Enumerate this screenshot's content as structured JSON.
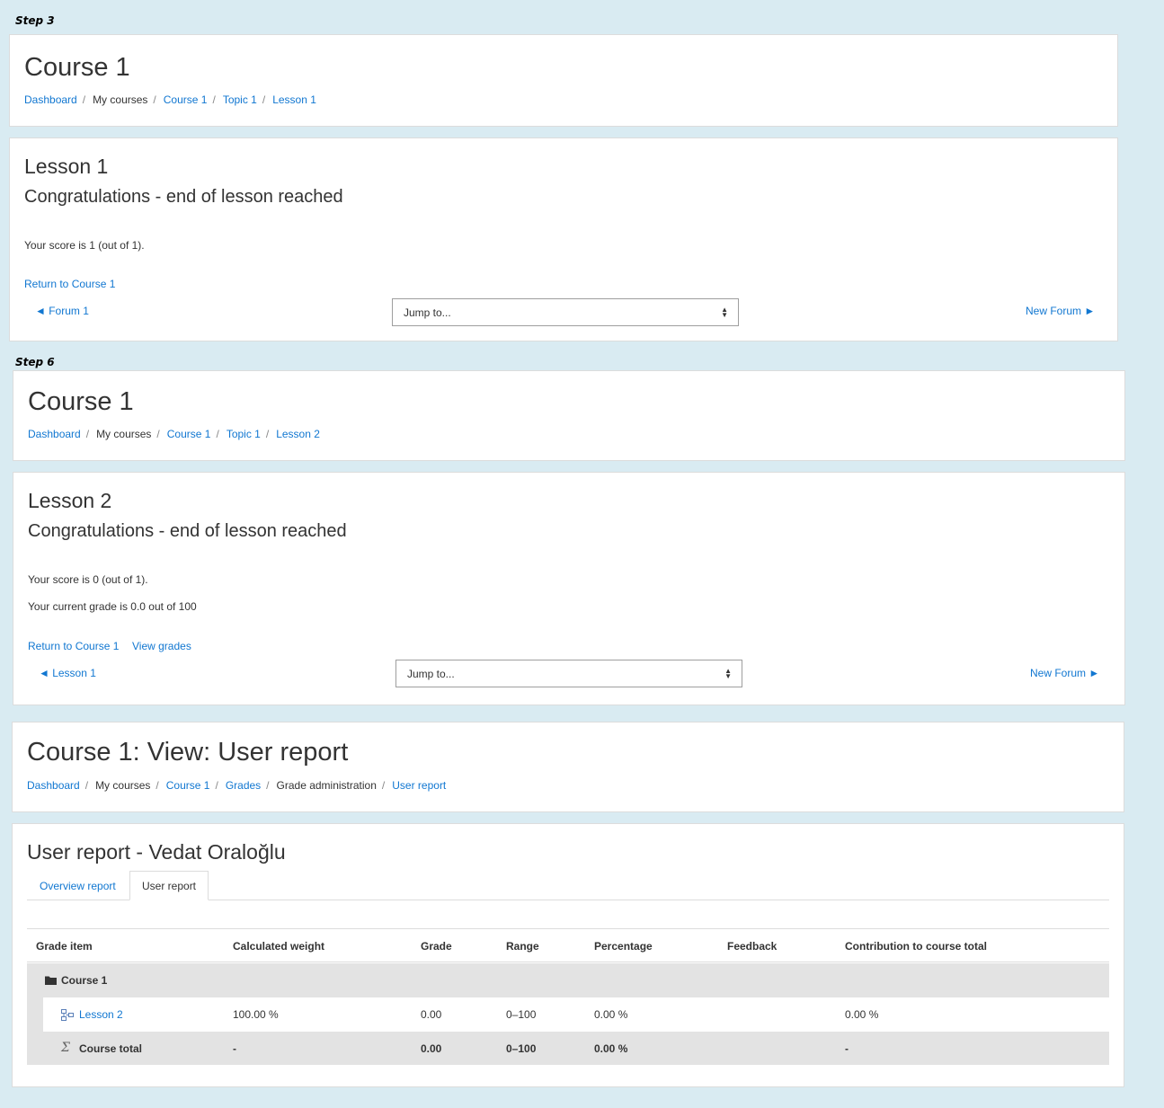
{
  "step3": {
    "label": "Step 3",
    "header": {
      "title": "Course 1",
      "breadcrumb": [
        "Dashboard",
        "My courses",
        "Course 1",
        "Topic 1",
        "Lesson 1"
      ]
    },
    "lesson": {
      "title": "Lesson 1",
      "subtitle": "Congratulations - end of lesson reached",
      "score": "Your score is 1 (out of 1).",
      "return_link": "Return to Course 1",
      "prev_link": "◄ Forum 1",
      "jump_placeholder": "Jump to...",
      "next_link": "New Forum ►"
    }
  },
  "step6": {
    "label": "Step 6",
    "header": {
      "title": "Course 1",
      "breadcrumb": [
        "Dashboard",
        "My courses",
        "Course 1",
        "Topic 1",
        "Lesson 2"
      ]
    },
    "lesson": {
      "title": "Lesson 2",
      "subtitle": "Congratulations - end of lesson reached",
      "score": "Your score is 0 (out of 1).",
      "grade": "Your current grade is 0.0 out of 100",
      "return_link": "Return to Course 1",
      "view_grades_link": "View grades",
      "prev_link": "◄ Lesson 1",
      "jump_placeholder": "Jump to...",
      "next_link": "New Forum ►"
    }
  },
  "report": {
    "header": {
      "title": "Course 1: View: User report",
      "breadcrumb": [
        "Dashboard",
        "My courses",
        "Course 1",
        "Grades",
        "Grade administration",
        "User report"
      ]
    },
    "title": "User report - Vedat Oraloğlu",
    "tabs": [
      {
        "label": "Overview report",
        "active": false
      },
      {
        "label": "User report",
        "active": true
      }
    ],
    "table": {
      "headers": [
        "Grade item",
        "Calculated weight",
        "Grade",
        "Range",
        "Percentage",
        "Feedback",
        "Contribution to course total"
      ],
      "category": {
        "name": "Course 1",
        "icon": "folder-icon"
      },
      "item": {
        "name": "Lesson 2",
        "icon": "lesson-icon",
        "weight": "100.00 %",
        "grade": "0.00",
        "range": "0–100",
        "percentage": "0.00 %",
        "feedback": "",
        "contribution": "0.00 %"
      },
      "total": {
        "name": "Course total",
        "icon": "sigma-icon",
        "weight": "-",
        "grade": "0.00",
        "range": "0–100",
        "percentage": "0.00 %",
        "feedback": "",
        "contribution": "-"
      }
    }
  },
  "colors": {
    "background": "#d9ebf2",
    "link": "#1177d1",
    "text": "#333333",
    "row_shade": "#e3e3e3"
  }
}
